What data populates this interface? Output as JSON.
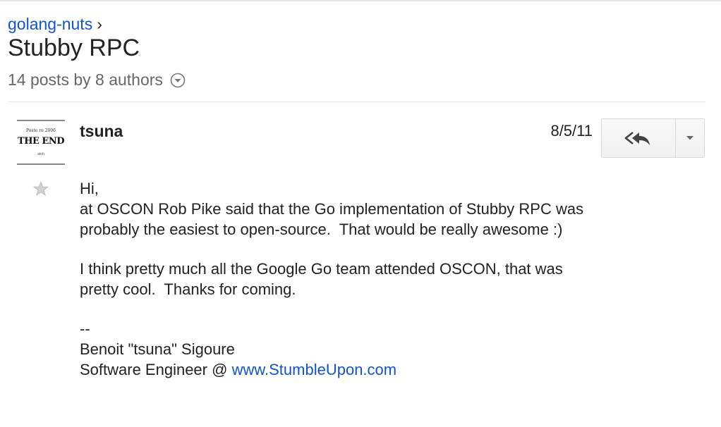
{
  "breadcrumb": {
    "group": "golang-nuts",
    "separator": "›"
  },
  "thread": {
    "title": "Stubby RPC",
    "summary": "14 posts by 8 authors"
  },
  "message": {
    "avatar": {
      "line1": "Poste re 2006",
      "line2": "THE END",
      "line3": "atoh"
    },
    "author": "tsuna",
    "date": "8/5/11",
    "body": {
      "greeting": "Hi,",
      "line1": "at OSCON Rob Pike said that the Go implementation of Stubby RPC was",
      "line2": "probably the easiest to open-source.  That would be really awesome :)",
      "line3": "I think pretty much all the Google Go team attended OSCON, that was",
      "line4": "pretty cool.  Thanks for coming.",
      "sig_dashes": "--",
      "sig_name": "Benoit \"tsuna\" Sigoure",
      "sig_title_prefix": "Software Engineer @ ",
      "sig_link": "www.StumbleUpon.com"
    }
  },
  "icons": {
    "summary_toggle": "chevron-down-circle-icon",
    "star": "star-icon",
    "reply": "reply-all-icon",
    "more": "caret-down-icon"
  },
  "colors": {
    "link": "#1155cc",
    "muted_text": "#666666",
    "divider": "#e5e5e5"
  }
}
